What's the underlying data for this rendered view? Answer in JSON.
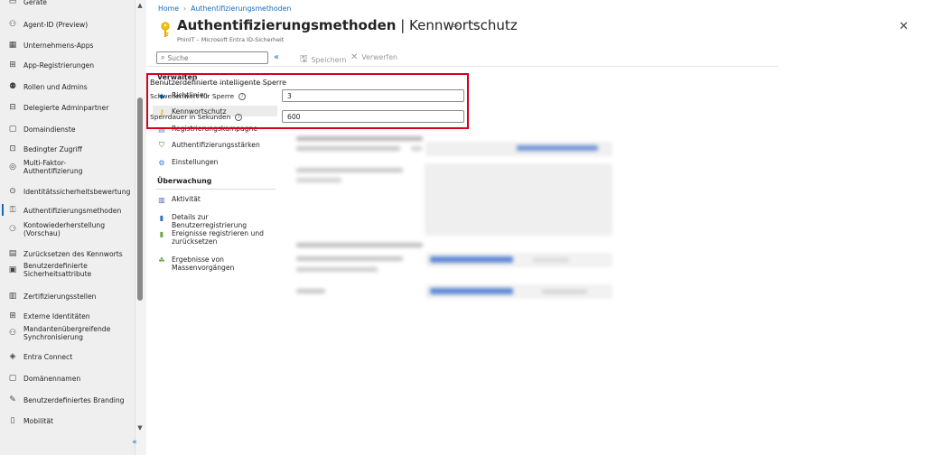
{
  "leftnav": {
    "items": [
      {
        "label": "Geräte",
        "icon": "devices-icon",
        "glyph": "▭"
      },
      {
        "label": "Agent-ID (Preview)",
        "icon": "agent-id-icon",
        "glyph": "⚇"
      },
      {
        "label": "Unternehmens-Apps",
        "icon": "enterprise-apps-icon",
        "glyph": "▦"
      },
      {
        "label": "App-Registrierungen",
        "icon": "app-registrations-icon",
        "glyph": "⊞"
      },
      {
        "label": "Rollen und Admins",
        "icon": "roles-icon",
        "glyph": "⚉"
      },
      {
        "label": "Delegierte Adminpartner",
        "icon": "delegated-admin-icon",
        "glyph": "⊟"
      },
      {
        "label": "Domaindienste",
        "icon": "domain-services-icon",
        "glyph": "▢"
      },
      {
        "label": "Bedingter Zugriff",
        "icon": "conditional-access-icon",
        "glyph": "⊡"
      },
      {
        "label": "Multi-Faktor-\nAuthentifizierung",
        "icon": "mfa-icon",
        "glyph": "◎"
      },
      {
        "label": "Identitätssicherheitsbewertung",
        "icon": "secure-score-icon",
        "glyph": "⊙"
      },
      {
        "label": "Authentifizierungsmethoden",
        "icon": "auth-methods-icon",
        "glyph": "⚿"
      },
      {
        "label": "Kontowiederherstellung\n(Vorschau)",
        "icon": "account-recovery-icon",
        "glyph": "⚆"
      },
      {
        "label": "Zurücksetzen des Kennworts",
        "icon": "password-reset-icon",
        "glyph": "▤"
      },
      {
        "label": "Benutzerdefinierte\nSicherheitsattribute",
        "icon": "security-attributes-icon",
        "glyph": "▣"
      },
      {
        "label": "Zertifizierungsstellen",
        "icon": "certificate-icon",
        "glyph": "▥"
      },
      {
        "label": "Externe Identitäten",
        "icon": "external-identities-icon",
        "glyph": "⊞"
      },
      {
        "label": "Mandantenübergreifende\nSynchronisierung",
        "icon": "cross-tenant-sync-icon",
        "glyph": "⚇"
      },
      {
        "label": "Entra Connect",
        "icon": "entra-connect-icon",
        "glyph": "◈"
      },
      {
        "label": "Domänennamen",
        "icon": "domain-names-icon",
        "glyph": "▢"
      },
      {
        "label": "Benutzerdefiniertes Branding",
        "icon": "branding-icon",
        "glyph": "✎"
      },
      {
        "label": "Mobilität",
        "icon": "mobility-icon",
        "glyph": "▯"
      }
    ]
  },
  "breadcrumb": [
    "Home",
    "Authentifizierungsmethoden"
  ],
  "header": {
    "title_main": "Authentifizierungsmethoden",
    "title_sep": " | ",
    "title_sub": "Kennwortschutz",
    "subtitle": "PhinIT – Microsoft Entra ID-Sicherheit"
  },
  "menu": {
    "search_placeholder": "Suche",
    "sections": [
      {
        "title": "Verwalten",
        "items": [
          {
            "label": "Richtlinien",
            "icon": "policies-icon",
            "glyph": "◆",
            "color": "#0f6cbd"
          },
          {
            "label": "Kennwortschutz",
            "icon": "key-icon",
            "glyph": "⚷",
            "color": "#e8b000"
          },
          {
            "label": "Registrierungskampagne",
            "icon": "registration-campaign-icon",
            "glyph": "▤",
            "color": "#5c9fd6"
          },
          {
            "label": "Authentifizierungsstärken",
            "icon": "shield-icon",
            "glyph": "⛉",
            "color": "#2e8b2e"
          },
          {
            "label": "Einstellungen",
            "icon": "settings-icon",
            "glyph": "⚙",
            "color": "#3a7bd5"
          }
        ]
      },
      {
        "title": "Überwachung",
        "items": [
          {
            "label": "Aktivität",
            "icon": "activity-icon",
            "glyph": "▥",
            "color": "#4a63c9"
          },
          {
            "label": "Details zur Benutzerregistrierung",
            "icon": "registration-details-icon",
            "glyph": "▮",
            "color": "#3a6fc2"
          },
          {
            "label": "Ereignisse registrieren und\nzurücksetzen",
            "icon": "events-icon",
            "glyph": "▮",
            "color": "#6aa84f"
          },
          {
            "label": "Ergebnisse von Massenvorgängen",
            "icon": "bulk-results-icon",
            "glyph": "☘",
            "color": "#5a9e3a"
          }
        ]
      }
    ]
  },
  "toolbar": {
    "save_label": "Speichern",
    "discard_label": "Verwerfen"
  },
  "lockout": {
    "title": "Benutzerdefinierte intelligente Sperre",
    "threshold_label": "Schwellenwert für Sperre",
    "threshold_value": "3",
    "duration_label": "Sperrdauer in Sekunden",
    "duration_value": "600"
  },
  "colors": {
    "accent": "#0f6cbd",
    "highlight": "#d9001b"
  }
}
